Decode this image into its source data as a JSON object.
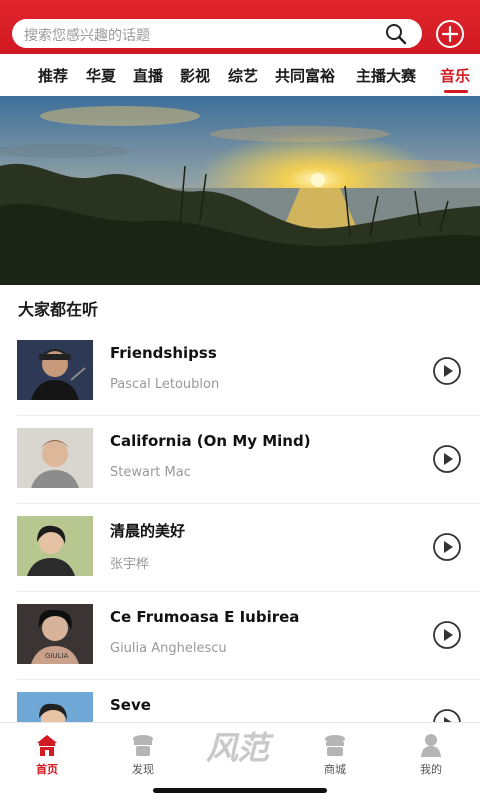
{
  "header": {
    "search_placeholder": "搜索您感兴趣的话题",
    "brand_color": "#d11a22"
  },
  "tabs": [
    {
      "label": "推荐",
      "active": false
    },
    {
      "label": "华夏",
      "active": false
    },
    {
      "label": "直播",
      "active": false
    },
    {
      "label": "影视",
      "active": false
    },
    {
      "label": "综艺",
      "active": false
    },
    {
      "label": "共同富裕",
      "active": false
    },
    {
      "label": "主播大赛",
      "active": false
    },
    {
      "label": "音乐",
      "active": true
    }
  ],
  "section": {
    "title": "大家都在听"
  },
  "songs": [
    {
      "title": "Friendshipss",
      "artist": "Pascal Letoublon"
    },
    {
      "title": "California (On My Mind)",
      "artist": "Stewart Mac"
    },
    {
      "title": "清晨的美好",
      "artist": "张宇桦"
    },
    {
      "title": "Ce Frumoasa E Iubirea",
      "artist": "Giulia Anghelescu"
    },
    {
      "title": "Seve",
      "artist": ""
    }
  ],
  "bottom_nav": {
    "items": [
      {
        "label": "首页",
        "icon": "home-icon",
        "active": true
      },
      {
        "label": "发现",
        "icon": "discover-icon",
        "active": false
      },
      {
        "label": "商城",
        "icon": "mall-icon",
        "active": false
      },
      {
        "label": "我的",
        "icon": "profile-icon",
        "active": false
      }
    ],
    "center_logo": "风范"
  }
}
